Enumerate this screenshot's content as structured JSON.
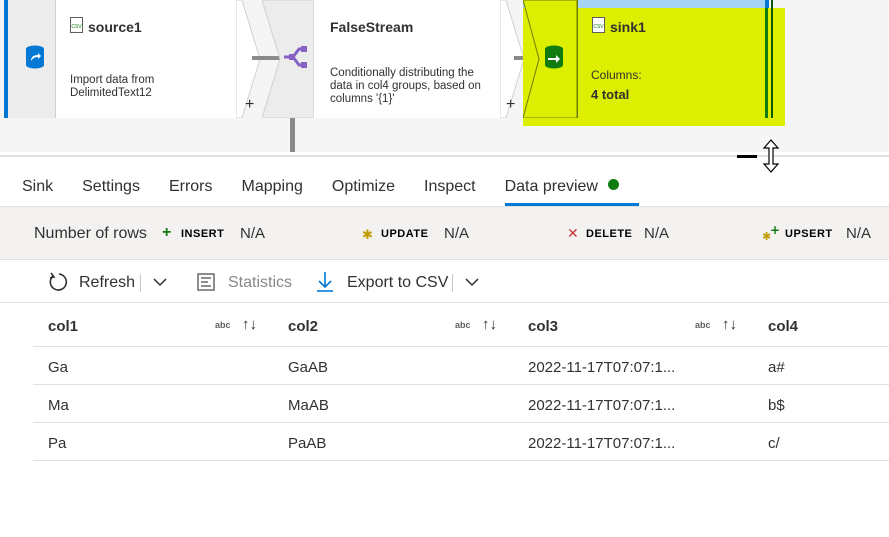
{
  "nodes": {
    "source": {
      "title": "source1",
      "description": "Import data from DelimitedText12"
    },
    "filter": {
      "title": "FalseStream",
      "description": "Conditionally distributing the data in col4 groups, based on columns '{1}'"
    },
    "sink": {
      "title": "sink1",
      "columns_label": "Columns:",
      "columns_value": "4 total"
    },
    "add_symbol": "+"
  },
  "tabs": [
    {
      "label": "Sink"
    },
    {
      "label": "Settings"
    },
    {
      "label": "Errors"
    },
    {
      "label": "Mapping"
    },
    {
      "label": "Optimize"
    },
    {
      "label": "Inspect"
    },
    {
      "label": "Data preview",
      "active": true
    }
  ],
  "row_counts": {
    "label": "Number of rows",
    "insert": {
      "label": "INSERT",
      "value": "N/A",
      "color": "#107c10"
    },
    "update": {
      "label": "UPDATE",
      "value": "N/A",
      "color": "#c19c00"
    },
    "delete": {
      "label": "DELETE",
      "value": "N/A",
      "color": "#d13438"
    },
    "upsert": {
      "label": "UPSERT",
      "value": "N/A"
    }
  },
  "toolbar": {
    "refresh": "Refresh",
    "statistics": "Statistics",
    "export": "Export to CSV"
  },
  "grid": {
    "columns": [
      {
        "name": "col1",
        "type": "abc"
      },
      {
        "name": "col2",
        "type": "abc"
      },
      {
        "name": "col3",
        "type": "abc"
      },
      {
        "name": "col4"
      }
    ],
    "rows": [
      [
        "Ga",
        "GaAB",
        "2022-11-17T07:07:1...",
        "a#"
      ],
      [
        "Ma",
        "MaAB",
        "2022-11-17T07:07:1...",
        "b$"
      ],
      [
        "Pa",
        "PaAB",
        "2022-11-17T07:07:1...",
        "c/"
      ]
    ]
  },
  "colors": {
    "accent": "#0078d4",
    "sink_highlight": "#dcef00",
    "status_ok": "#107c10"
  }
}
